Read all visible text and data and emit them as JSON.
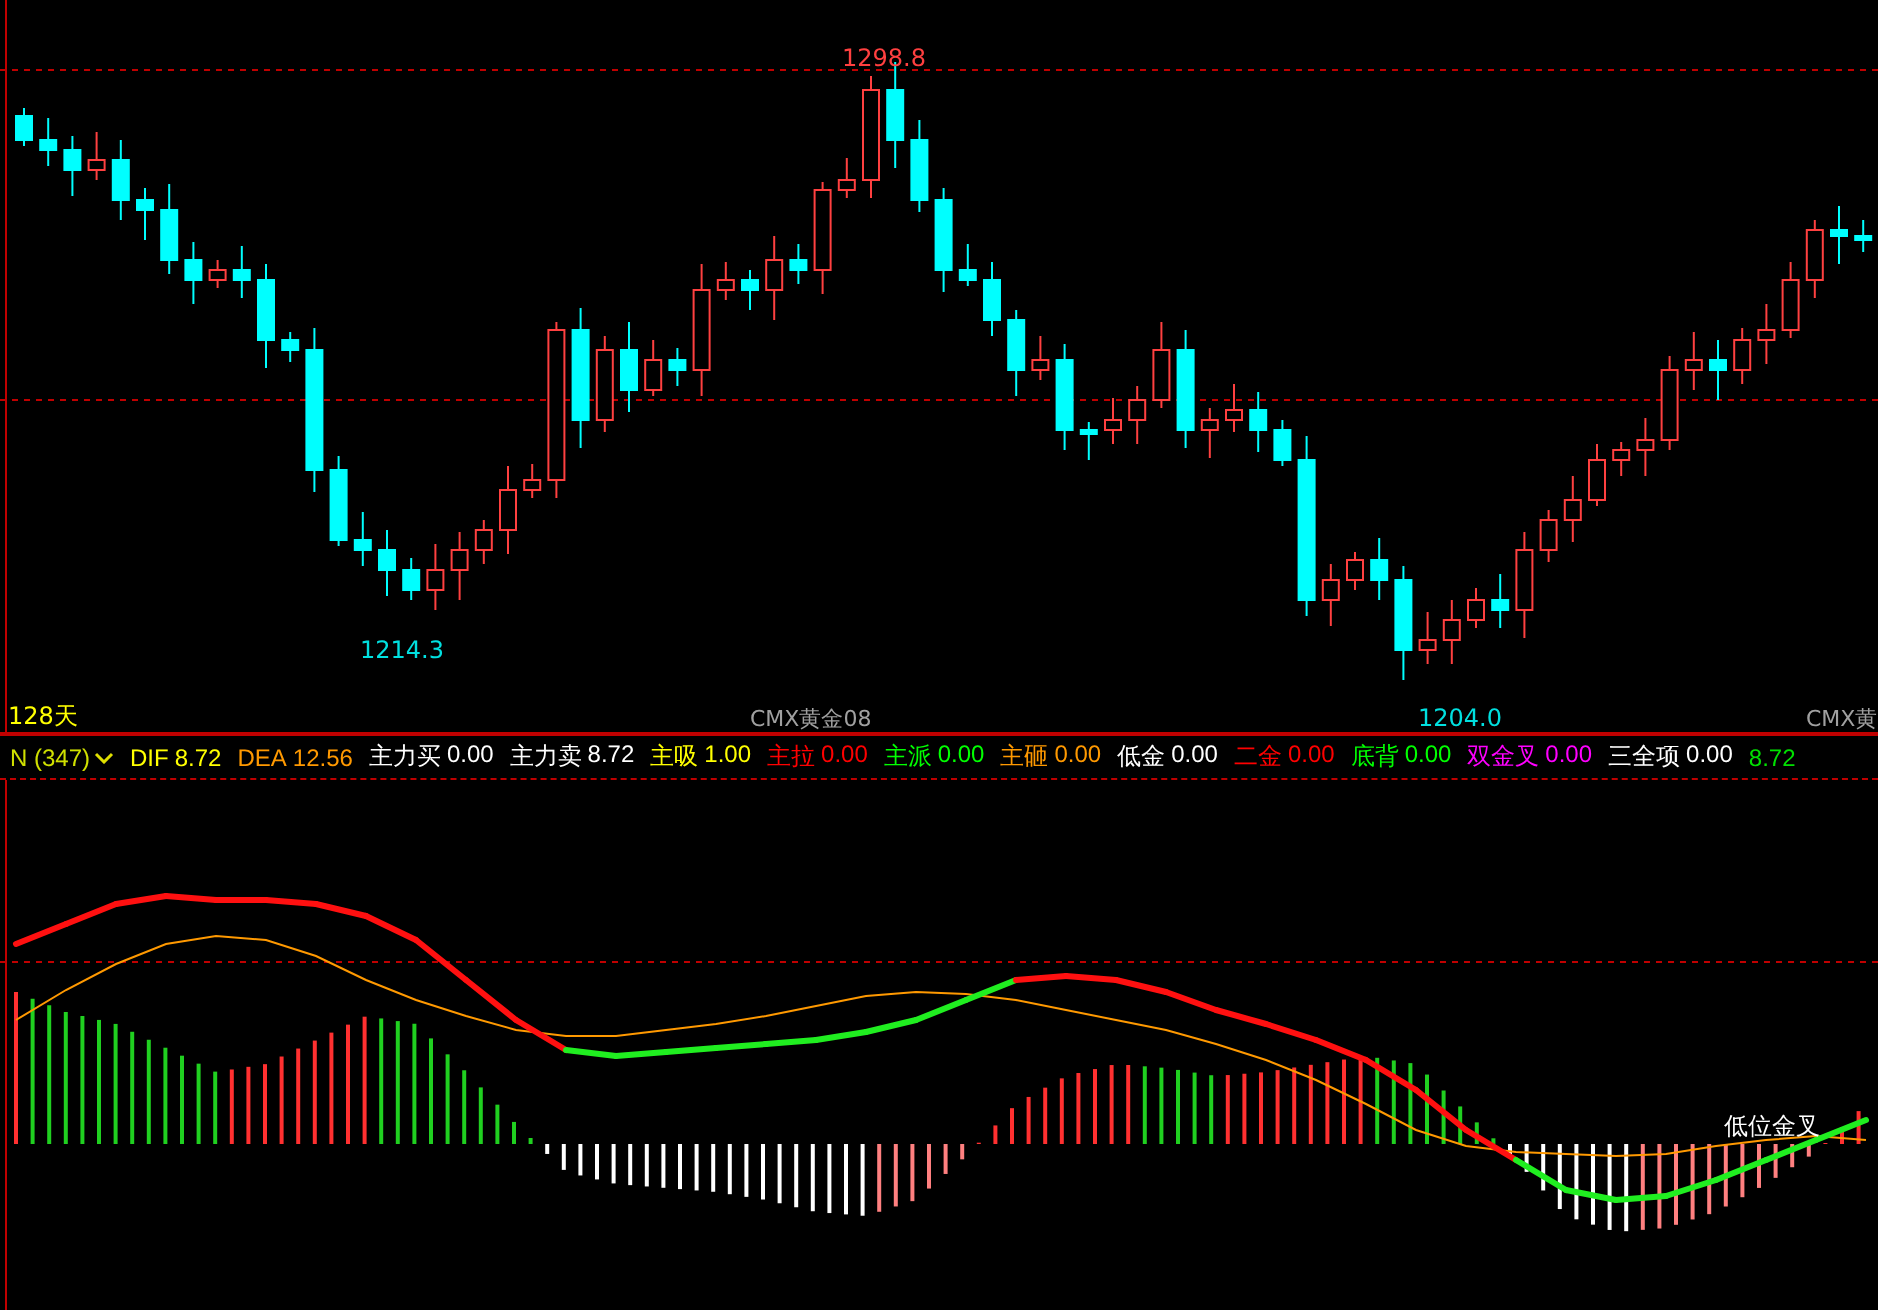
{
  "price_panel": {
    "high_label": "1298.8",
    "low_labels": [
      "1214.3",
      "1204.0"
    ],
    "period": "128天",
    "contract_labels": [
      "CMX黄金08",
      "CMX黄"
    ]
  },
  "indicator_bar": {
    "selector": "N (347)",
    "items": [
      {
        "name": "DIF",
        "value": "8.72",
        "color": "#ffff00"
      },
      {
        "name": "DEA",
        "value": "12.56",
        "color": "#ff9900"
      },
      {
        "name": "主力买",
        "value": "0.00",
        "color": "#ffffff"
      },
      {
        "name": "主力卖",
        "value": "8.72",
        "color": "#ffffff"
      },
      {
        "name": "主吸",
        "value": "1.00",
        "color": "#ffff00"
      },
      {
        "name": "主拉",
        "value": "0.00",
        "color": "#ff0000"
      },
      {
        "name": "主派",
        "value": "0.00",
        "color": "#00ff00"
      },
      {
        "name": "主砸",
        "value": "0.00",
        "color": "#ff9900"
      },
      {
        "name": "低金",
        "value": "0.00",
        "color": "#ffffff"
      },
      {
        "name": "二金",
        "value": "0.00",
        "color": "#ff0000"
      },
      {
        "name": "底背",
        "value": "0.00",
        "color": "#00ff00"
      },
      {
        "name": "双金叉",
        "value": "0.00",
        "color": "#ff00ff"
      },
      {
        "name": "三全项",
        "value": "0.00",
        "color": "#ffffff"
      },
      {
        "value": "8.72",
        "color": "#00e000"
      }
    ]
  },
  "signal_label": "低位金叉"
}
